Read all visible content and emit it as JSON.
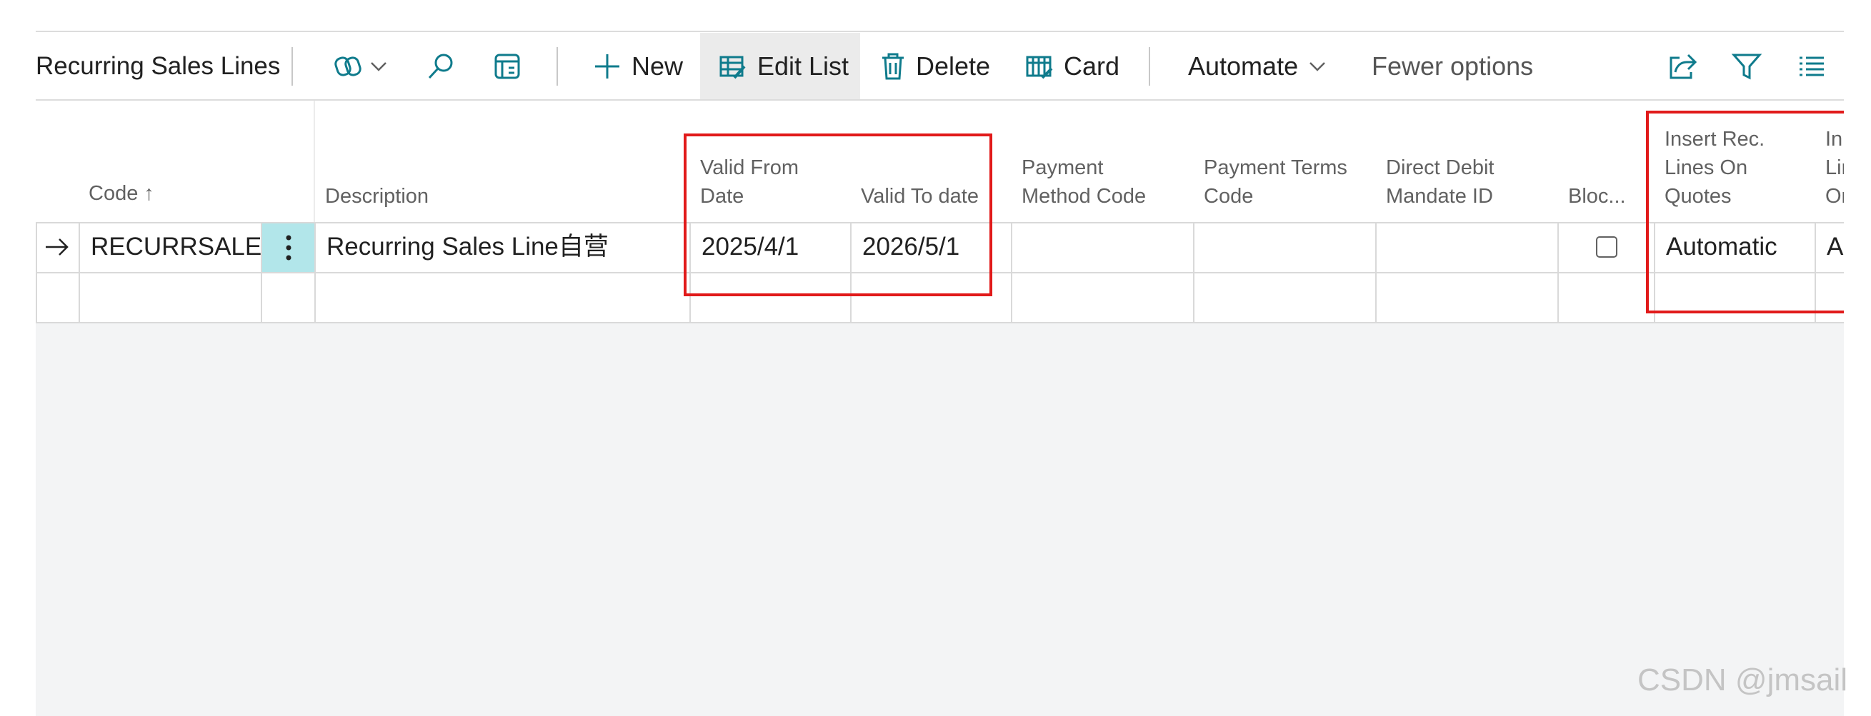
{
  "toolbar": {
    "title": "Recurring Sales Lines",
    "new_label": "New",
    "edit_list_label": "Edit List",
    "delete_label": "Delete",
    "card_label": "Card",
    "automate_label": "Automate",
    "fewer_options_label": "Fewer options"
  },
  "columns": {
    "code": "Code ↑",
    "description": "Description",
    "valid_from_l1": "Valid From",
    "valid_from_l2": "Date",
    "valid_to": "Valid To date",
    "payment_method_l1": "Payment",
    "payment_method_l2": "Method Code",
    "payment_terms_l1": "Payment Terms",
    "payment_terms_l2": "Code",
    "direct_debit_l1": "Direct Debit",
    "direct_debit_l2": "Mandate ID",
    "blocked": "Bloc...",
    "insert_quotes_l1": "Insert Rec.",
    "insert_quotes_l2": "Lines On",
    "insert_quotes_l3": "Quotes",
    "insert_next_l1": "In",
    "insert_next_l2": "Lir",
    "insert_next_l3": "Or"
  },
  "rows": [
    {
      "code": "RECURRSALE",
      "description": "Recurring Sales Line自营",
      "valid_from": "2025/4/1",
      "valid_to": "2026/5/1",
      "payment_method": "",
      "payment_terms": "",
      "direct_debit": "",
      "blocked": false,
      "insert_on_quotes": "Automatic",
      "insert_next": "A"
    }
  ],
  "watermark": "CSDN @jmsail",
  "colors": {
    "accent": "#0f7b8c",
    "selected_cell": "#b2e6ea",
    "highlight": "#e11a1a"
  },
  "icons": [
    "copilot-icon",
    "chevron-down-icon",
    "search-icon",
    "analysis-icon",
    "plus-icon",
    "edit-list-icon",
    "delete-icon",
    "card-icon",
    "share-icon",
    "filter-icon",
    "list-view-icon",
    "arrow-right-icon",
    "more-options-icon"
  ]
}
